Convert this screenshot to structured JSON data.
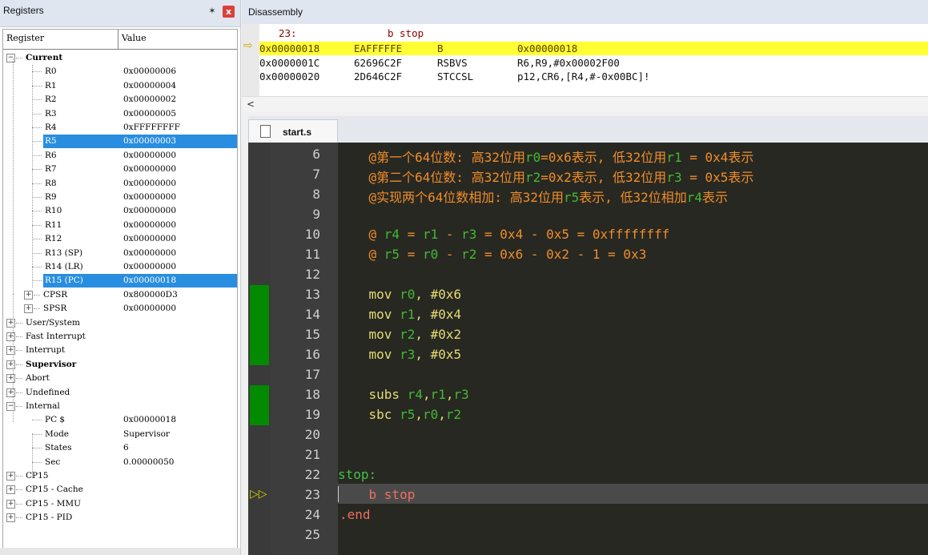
{
  "registers_panel": {
    "title": "Registers",
    "pin_icon": "✶",
    "close_icon": "x",
    "columns": [
      "Register",
      "Value"
    ],
    "rows": [
      {
        "label": "Current",
        "value": "",
        "level": 0,
        "expander": "minus",
        "bold": true
      },
      {
        "label": "R0",
        "value": "0x00000006",
        "level": 2
      },
      {
        "label": "R1",
        "value": "0x00000004",
        "level": 2
      },
      {
        "label": "R2",
        "value": "0x00000002",
        "level": 2
      },
      {
        "label": "R3",
        "value": "0x00000005",
        "level": 2
      },
      {
        "label": "R4",
        "value": "0xFFFFFFFF",
        "level": 2
      },
      {
        "label": "R5",
        "value": "0x00000003",
        "level": 2,
        "selected": true
      },
      {
        "label": "R6",
        "value": "0x00000000",
        "level": 2
      },
      {
        "label": "R7",
        "value": "0x00000000",
        "level": 2
      },
      {
        "label": "R8",
        "value": "0x00000000",
        "level": 2
      },
      {
        "label": "R9",
        "value": "0x00000000",
        "level": 2
      },
      {
        "label": "R10",
        "value": "0x00000000",
        "level": 2
      },
      {
        "label": "R11",
        "value": "0x00000000",
        "level": 2
      },
      {
        "label": "R12",
        "value": "0x00000000",
        "level": 2
      },
      {
        "label": "R13 (SP)",
        "value": "0x00000000",
        "level": 2
      },
      {
        "label": "R14 (LR)",
        "value": "0x00000000",
        "level": 2
      },
      {
        "label": "R15 (PC)",
        "value": "0x00000018",
        "level": 2,
        "selected": true
      },
      {
        "label": "CPSR",
        "value": "0x800000D3",
        "level": 1,
        "expander": "plus"
      },
      {
        "label": "SPSR",
        "value": "0x00000000",
        "level": 1,
        "expander": "plus"
      },
      {
        "label": "User/System",
        "value": "",
        "level": 0,
        "expander": "plus"
      },
      {
        "label": "Fast Interrupt",
        "value": "",
        "level": 0,
        "expander": "plus"
      },
      {
        "label": "Interrupt",
        "value": "",
        "level": 0,
        "expander": "plus"
      },
      {
        "label": "Supervisor",
        "value": "",
        "level": 0,
        "expander": "plus",
        "bold": true
      },
      {
        "label": "Abort",
        "value": "",
        "level": 0,
        "expander": "plus"
      },
      {
        "label": "Undefined",
        "value": "",
        "level": 0,
        "expander": "plus"
      },
      {
        "label": "Internal",
        "value": "",
        "level": 0,
        "expander": "minus"
      },
      {
        "label": "PC  $",
        "value": "0x00000018",
        "level": 2
      },
      {
        "label": "Mode",
        "value": "Supervisor",
        "level": 2
      },
      {
        "label": "States",
        "value": "6",
        "level": 2
      },
      {
        "label": "Sec",
        "value": "0.00000050",
        "level": 2
      },
      {
        "label": "CP15",
        "value": "",
        "level": 0,
        "expander": "plus"
      },
      {
        "label": "CP15 - Cache",
        "value": "",
        "level": 0,
        "expander": "plus"
      },
      {
        "label": "CP15 - MMU",
        "value": "",
        "level": 0,
        "expander": "plus"
      },
      {
        "label": "CP15 - PID",
        "value": "",
        "level": 0,
        "expander": "plus"
      }
    ]
  },
  "disassembly": {
    "title": "Disassembly",
    "current_arrow": "⇨",
    "scroll_left": "<",
    "source_line": {
      "num": "23:",
      "text": "b stop"
    },
    "rows": [
      {
        "addr": "0x00000018",
        "opcode": "EAFFFFFE",
        "mnemonic": "B",
        "operands": "0x00000018",
        "current": true
      },
      {
        "addr": "0x0000001C",
        "opcode": "62696C2F",
        "mnemonic": "RSBVS",
        "operands": "R6,R9,#0x00002F00"
      },
      {
        "addr": "0x00000020",
        "opcode": "2D646C2F",
        "mnemonic": "STCCSL",
        "operands": "p12,CR6,[R4,#-0x00BC]!"
      }
    ]
  },
  "editor": {
    "tab_label": "start.s",
    "exec_arrow": "▷▷",
    "lines": [
      {
        "num": "6",
        "tokens": [
          {
            "t": "    @第一个64位数: 高32位用",
            "c": "cmt"
          },
          {
            "t": "r0",
            "c": "green"
          },
          {
            "t": "=0x6表示, 低32位用",
            "c": "cmt"
          },
          {
            "t": "r1",
            "c": "green"
          },
          {
            "t": " = 0x4表示",
            "c": "cmt"
          }
        ]
      },
      {
        "num": "7",
        "tokens": [
          {
            "t": "    @第二个64位数: 高32位用",
            "c": "cmt"
          },
          {
            "t": "r2",
            "c": "green"
          },
          {
            "t": "=0x2表示, 低32位用",
            "c": "cmt"
          },
          {
            "t": "r3",
            "c": "green"
          },
          {
            "t": " = 0x5表示",
            "c": "cmt"
          }
        ]
      },
      {
        "num": "8",
        "tokens": [
          {
            "t": "    @实现两个64位数相加: 高32位用",
            "c": "cmt"
          },
          {
            "t": "r5",
            "c": "green"
          },
          {
            "t": "表示, 低32位相加",
            "c": "cmt"
          },
          {
            "t": "r4",
            "c": "green"
          },
          {
            "t": "表示",
            "c": "cmt"
          }
        ]
      },
      {
        "num": "9",
        "tokens": []
      },
      {
        "num": "10",
        "tokens": [
          {
            "t": "    @ ",
            "c": "cmt"
          },
          {
            "t": "r4",
            "c": "green"
          },
          {
            "t": " = ",
            "c": "cmt"
          },
          {
            "t": "r1",
            "c": "green"
          },
          {
            "t": " - ",
            "c": "cmt"
          },
          {
            "t": "r3",
            "c": "green"
          },
          {
            "t": " = 0x4 - 0x5 = 0xffffffff",
            "c": "cmt"
          }
        ]
      },
      {
        "num": "11",
        "tokens": [
          {
            "t": "    @ ",
            "c": "cmt"
          },
          {
            "t": "r5",
            "c": "green"
          },
          {
            "t": " = ",
            "c": "cmt"
          },
          {
            "t": "r0",
            "c": "green"
          },
          {
            "t": " - ",
            "c": "cmt"
          },
          {
            "t": "r2",
            "c": "green"
          },
          {
            "t": " = 0x6 - 0x2 - 1 = 0x3",
            "c": "cmt"
          }
        ]
      },
      {
        "num": "12",
        "tokens": []
      },
      {
        "num": "13",
        "tokens": [
          {
            "t": "    mov ",
            "c": "yellow"
          },
          {
            "t": "r0",
            "c": "green"
          },
          {
            "t": ", #0x6",
            "c": "yellow"
          }
        ]
      },
      {
        "num": "14",
        "tokens": [
          {
            "t": "    mov ",
            "c": "yellow"
          },
          {
            "t": "r1",
            "c": "green"
          },
          {
            "t": ", #0x4",
            "c": "yellow"
          }
        ]
      },
      {
        "num": "15",
        "tokens": [
          {
            "t": "    mov ",
            "c": "yellow"
          },
          {
            "t": "r2",
            "c": "green"
          },
          {
            "t": ", #0x2",
            "c": "yellow"
          }
        ]
      },
      {
        "num": "16",
        "tokens": [
          {
            "t": "    mov ",
            "c": "yellow"
          },
          {
            "t": "r3",
            "c": "green"
          },
          {
            "t": ", #0x5",
            "c": "yellow"
          }
        ]
      },
      {
        "num": "17",
        "tokens": []
      },
      {
        "num": "18",
        "tokens": [
          {
            "t": "    subs ",
            "c": "yellow"
          },
          {
            "t": "r4",
            "c": "green"
          },
          {
            "t": ",",
            "c": "yellow"
          },
          {
            "t": "r1",
            "c": "green"
          },
          {
            "t": ",",
            "c": "yellow"
          },
          {
            "t": "r3",
            "c": "green"
          }
        ]
      },
      {
        "num": "19",
        "tokens": [
          {
            "t": "    sbc ",
            "c": "yellow"
          },
          {
            "t": "r5",
            "c": "green"
          },
          {
            "t": ",",
            "c": "yellow"
          },
          {
            "t": "r0",
            "c": "green"
          },
          {
            "t": ",",
            "c": "yellow"
          },
          {
            "t": "r2",
            "c": "green"
          }
        ]
      },
      {
        "num": "20",
        "tokens": []
      },
      {
        "num": "21",
        "tokens": []
      },
      {
        "num": "22",
        "tokens": [
          {
            "t": "stop:",
            "c": "label"
          }
        ]
      },
      {
        "num": "23",
        "tokens": [
          {
            "t": "    b stop",
            "c": "dir"
          }
        ]
      },
      {
        "num": "24",
        "tokens": [
          {
            "t": ".end",
            "c": "dir"
          }
        ]
      },
      {
        "num": "25",
        "tokens": []
      }
    ]
  },
  "colors": {
    "selection": "#2a8ee0",
    "current_instruction": "#ffff33",
    "editor_bg": "#272822",
    "breakpoint_marker": "#038a00"
  }
}
